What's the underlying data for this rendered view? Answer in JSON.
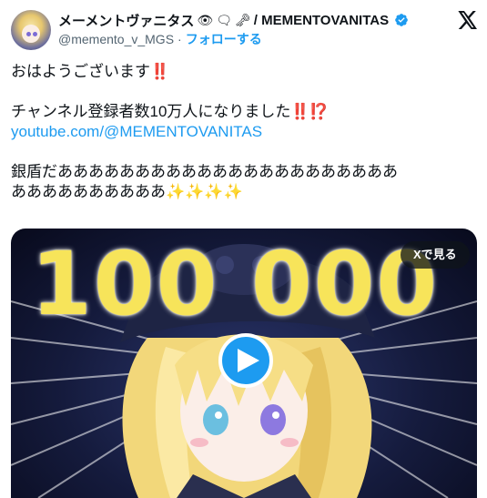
{
  "author": {
    "display_name": "メーメントヴァニタス",
    "name_emojis": [
      "👁",
      "🗨",
      "🗝"
    ],
    "name_suffix": "/ MEMENTOVANITAS",
    "handle": "@memento_v_MGS",
    "separator": "·",
    "follow_label": "フォローする",
    "verified": true
  },
  "tweet": {
    "line1": "おはようございます",
    "line1_mark": "‼️",
    "line2": "チャンネル登録者数10万人になりました",
    "line2_mark": "‼️⁉️",
    "link": "youtube.com/@MEMENTOVANITAS",
    "line4": "銀盾だああああああああああああああああああああああ",
    "line5": "ああああああああああ",
    "line5_mark": "✨✨✨✨"
  },
  "media": {
    "overlay_number": "100 000",
    "watch_on_x_label": "Xで見る",
    "play_icon": "play-icon"
  },
  "colors": {
    "link": "#1d9bf0",
    "verified": "#1d9bf0",
    "exclamation": "#e0273b",
    "number_yellow": "#f7e45a"
  }
}
